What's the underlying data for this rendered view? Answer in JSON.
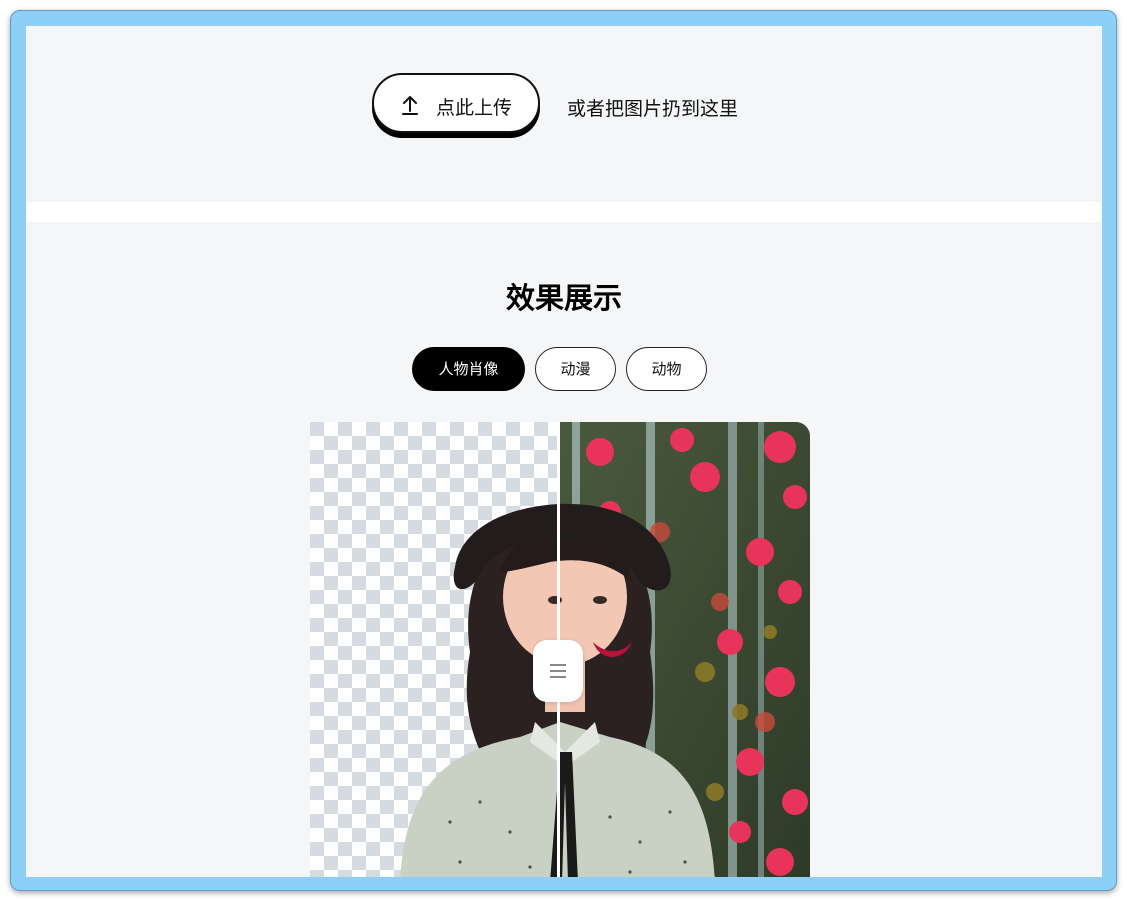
{
  "upload": {
    "button_label": "点此上传",
    "icon": "upload-arrow-icon",
    "drop_hint": "或者把图片扔到这里"
  },
  "showcase": {
    "title": "效果展示",
    "tabs": [
      {
        "label": "人物肖像",
        "active": true
      },
      {
        "label": "动漫",
        "active": false
      },
      {
        "label": "动物",
        "active": false
      }
    ],
    "compare": {
      "left_view": "removed-background",
      "right_view": "original-photo",
      "handle_icon": "drag-handle-icon"
    }
  },
  "colors": {
    "frame": "#8ecff8",
    "page_bg": "#f4f6f8",
    "accent": "#000000",
    "flower": "#e8345a"
  }
}
